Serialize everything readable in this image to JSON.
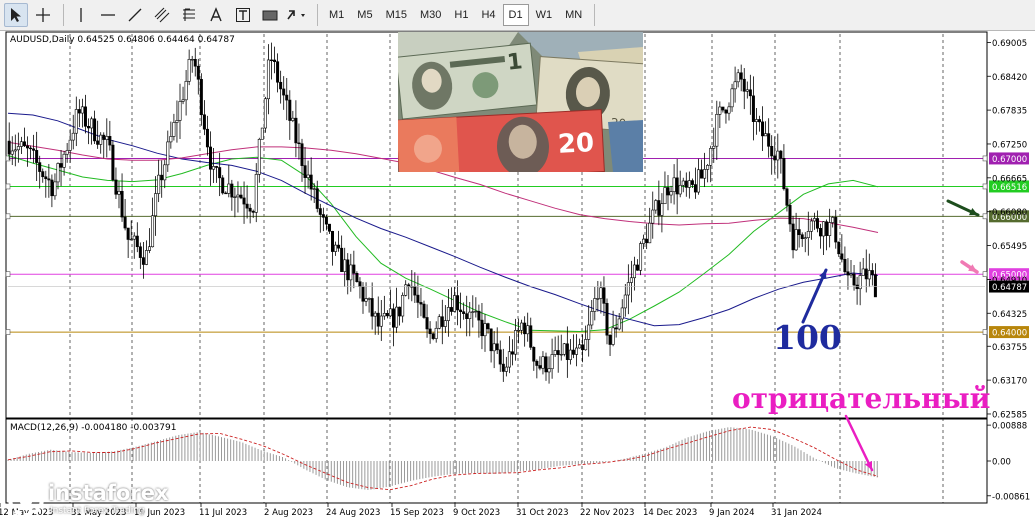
{
  "toolbar": {
    "tools": [
      {
        "name": "cursor-icon",
        "glyph": "↖"
      },
      {
        "name": "crosshair-icon",
        "glyph": "✛"
      },
      {
        "name": "vertical-line-icon",
        "glyph": "|"
      },
      {
        "name": "horizontal-line-icon",
        "glyph": "—"
      },
      {
        "name": "trendline-icon",
        "glyph": "∕"
      },
      {
        "name": "channel-icon",
        "glyph": "⫽"
      },
      {
        "name": "fibonacci-icon",
        "glyph": "F"
      },
      {
        "name": "text-icon",
        "glyph": "A"
      },
      {
        "name": "text-label-icon",
        "glyph": "T"
      },
      {
        "name": "shapes-icon",
        "glyph": "▬"
      },
      {
        "name": "arrows-icon",
        "glyph": "⤴"
      }
    ],
    "timeframes": [
      "M1",
      "M5",
      "M15",
      "M30",
      "H1",
      "H4",
      "D1",
      "W1",
      "MN"
    ],
    "active_timeframe": "D1"
  },
  "chart_data": {
    "type": "candlestick",
    "symbol_header": "AUDUSD,Daily  0.64525 0.64806 0.64464 0.64787",
    "price_axis_labels": [
      "0.69005",
      "0.68420",
      "0.67835",
      "0.67250",
      "0.66665",
      "0.66080",
      "0.65495",
      "0.64910",
      "0.64325",
      "0.63755",
      "0.63170",
      "0.62585"
    ],
    "ylim": [
      0.6255,
      0.6915
    ],
    "date_labels": [
      "12 May 2023",
      "31 May 2023",
      "19 Jun 2023",
      "11 Jul 2023",
      "2 Aug 2023",
      "24 Aug 2023",
      "15 Sep 2023",
      "9 Oct 2023",
      "31 Oct 2023",
      "22 Nov 2023",
      "14 Dec 2023",
      "9 Jan 2024",
      "31 Jan 2024"
    ],
    "current_price": {
      "label": "0.64787",
      "value": 0.64787
    },
    "horizontal_levels": [
      {
        "label": "0.67000",
        "value": 0.67,
        "color": "#a020b0"
      },
      {
        "label": "0.66516",
        "value": 0.66516,
        "color": "#22cc22"
      },
      {
        "label": "0.66000",
        "value": 0.66,
        "color": "#556b2f"
      },
      {
        "label": "0.65000",
        "value": 0.65,
        "color": "#e040e0"
      },
      {
        "label": "0.64000",
        "value": 0.64,
        "color": "#b8860b"
      }
    ],
    "moving_averages": [
      {
        "color": "#22bb22",
        "values": [
          0.6705,
          0.6692,
          0.668,
          0.6668,
          0.6662,
          0.666,
          0.6663,
          0.6674,
          0.6688,
          0.6699,
          0.6702,
          0.6697,
          0.6669,
          0.6622,
          0.6565,
          0.6519,
          0.6493,
          0.6474,
          0.6454,
          0.6434,
          0.6418,
          0.6403,
          0.6402,
          0.6401,
          0.6404,
          0.6422,
          0.6445,
          0.6469,
          0.6501,
          0.6534,
          0.6574,
          0.6606,
          0.6638,
          0.6656,
          0.6662,
          0.6651
        ]
      },
      {
        "color": "#1a1a8c",
        "values": [
          0.6778,
          0.6775,
          0.6765,
          0.6749,
          0.6733,
          0.6722,
          0.6709,
          0.6699,
          0.6693,
          0.6688,
          0.6678,
          0.6662,
          0.6639,
          0.6618,
          0.6597,
          0.6579,
          0.6564,
          0.6547,
          0.653,
          0.6512,
          0.6495,
          0.6479,
          0.6465,
          0.6449,
          0.6434,
          0.6422,
          0.6411,
          0.6413,
          0.6425,
          0.6439,
          0.6458,
          0.6474,
          0.6486,
          0.6494,
          0.6502,
          0.6498
        ]
      },
      {
        "color": "#c0307a",
        "values": [
          0.6728,
          0.6721,
          0.6714,
          0.6706,
          0.6699,
          0.6697,
          0.6697,
          0.6701,
          0.6708,
          0.6715,
          0.672,
          0.672,
          0.6718,
          0.6714,
          0.6708,
          0.67,
          0.6692,
          0.668,
          0.6667,
          0.6655,
          0.664,
          0.6627,
          0.6614,
          0.6603,
          0.6596,
          0.6591,
          0.6587,
          0.6585,
          0.6587,
          0.6588,
          0.6593,
          0.6597,
          0.6596,
          0.6589,
          0.6581,
          0.6572
        ]
      }
    ],
    "macd": {
      "header": "MACD(12,26,9) -0.004180 -0.003791",
      "axis_labels": [
        "0.00888",
        "0.00",
        "-0.00861"
      ],
      "ylim": [
        -0.0099,
        0.0099
      ],
      "hist": [
        0.0003,
        0.0018,
        0.0028,
        0.0022,
        0.002,
        0.0024,
        0.0035,
        0.0049,
        0.0064,
        0.0072,
        0.006,
        0.0047,
        0.0025,
        0.0009,
        -0.0021,
        -0.0047,
        -0.0065,
        -0.0072,
        -0.0063,
        -0.0049,
        -0.0039,
        -0.0032,
        -0.003,
        -0.0032,
        -0.0026,
        -0.0021,
        -0.0012,
        -0.0008,
        -0.0004,
        0.0005,
        0.0018,
        0.0034,
        0.0058,
        0.0074,
        0.0084,
        0.0078,
        0.0062,
        0.0038,
        0.0007,
        -0.0018,
        -0.0031,
        -0.0041
      ],
      "signal": [
        0.0003,
        0.0012,
        0.0023,
        0.0025,
        0.0021,
        0.0021,
        0.0031,
        0.0045,
        0.0056,
        0.0067,
        0.0068,
        0.0054,
        0.0038,
        0.0016,
        -0.0009,
        -0.0031,
        -0.0053,
        -0.0066,
        -0.0071,
        -0.0061,
        -0.0045,
        -0.0035,
        -0.0031,
        -0.003,
        -0.0029,
        -0.0022,
        -0.0017,
        -0.0009,
        -0.0005,
        0.0002,
        0.0012,
        0.0029,
        0.0044,
        0.006,
        0.0075,
        0.0084,
        0.0078,
        0.0057,
        0.0033,
        0.0004,
        -0.0022,
        -0.0038
      ]
    }
  },
  "annotations": {
    "label_100": "100",
    "label_negative": "отрицательный"
  },
  "watermark": {
    "brand": "instaforex",
    "tagline": "Instant Forex Trading"
  },
  "colors": {
    "bull_candle": "#ffffff",
    "bear_candle": "#000000",
    "price_tag_bg": "#000000",
    "grid": "#000000",
    "arrow_green": "#1d4d1d",
    "arrow_pink": "#f07ab4",
    "arrow_blue": "#1f2b9e",
    "arrow_magenta": "#ea1ec2"
  }
}
